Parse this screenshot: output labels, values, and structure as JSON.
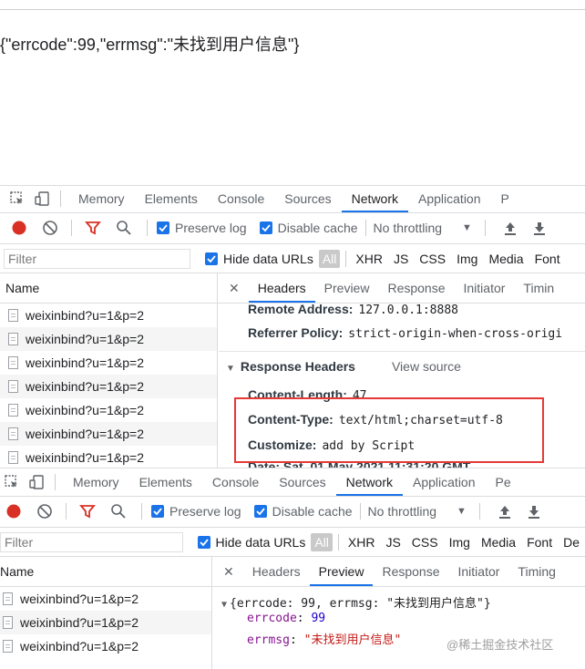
{
  "page": {
    "response_text": "{\"errcode\":99,\"errmsg\":\"未找到用户信息\"}"
  },
  "devtools_tabs": [
    "Memory",
    "Elements",
    "Console",
    "Sources",
    "Network",
    "Application"
  ],
  "devtools_tab_active": "Network",
  "top_panel": {
    "tab_cut": "P",
    "preserve_log": "Preserve log",
    "disable_cache": "Disable cache",
    "throttling": "No throttling",
    "filter_placeholder": "Filter",
    "hide_data_urls": "Hide data URLs",
    "all": "All",
    "types": [
      "XHR",
      "JS",
      "CSS",
      "Img",
      "Media",
      "Font"
    ],
    "name_header": "Name",
    "requests": [
      "weixinbind?u=1&p=2",
      "weixinbind?u=1&p=2",
      "weixinbind?u=1&p=2",
      "weixinbind?u=1&p=2",
      "weixinbind?u=1&p=2",
      "weixinbind?u=1&p=2",
      "weixinbind?u=1&p=2"
    ],
    "detail_tabs": [
      "Headers",
      "Preview",
      "Response",
      "Initiator",
      "Timin"
    ],
    "detail_active": "Headers",
    "remote_address_label": "Remote Address:",
    "remote_address_value": "127.0.0.1:8888",
    "referrer_policy_label": "Referrer Policy:",
    "referrer_policy_value": "strict-origin-when-cross-origi",
    "response_headers_title": "Response Headers",
    "view_source": "View source",
    "content_length_label": "Content-Length:",
    "content_length_value": "47",
    "content_type_label": "Content-Type:",
    "content_type_value": "text/html;charset=utf-8",
    "customize_label": "Customize:",
    "customize_value": "add by Script",
    "date_cut": "Date: Sat, 01 May 2021 11:31:20 GMT"
  },
  "bottom_panel": {
    "tab_cut": "Pe",
    "preserve_log": "Preserve log",
    "disable_cache": "Disable cache",
    "throttling": "No throttling",
    "filter_placeholder": "Filter",
    "hide_data_urls": "Hide data URLs",
    "all": "All",
    "types": [
      "XHR",
      "JS",
      "CSS",
      "Img",
      "Media",
      "Font",
      "De"
    ],
    "name_header": "Name",
    "requests": [
      "weixinbind?u=1&p=2",
      "weixinbind?u=1&p=2",
      "weixinbind?u=1&p=2"
    ],
    "detail_tabs": [
      "Headers",
      "Preview",
      "Response",
      "Initiator",
      "Timing"
    ],
    "detail_active": "Preview",
    "preview_summary": "{errcode: 99, errmsg: \"未找到用户信息\"}",
    "preview_key1": "errcode",
    "preview_val1": "99",
    "preview_key2": "errmsg",
    "preview_val2": "\"未找到用户信息\""
  },
  "watermark": "@稀土掘金技术社区",
  "colors": {
    "accent": "#1a73e8",
    "record": "#d93025",
    "highlight_box": "#e53935"
  }
}
